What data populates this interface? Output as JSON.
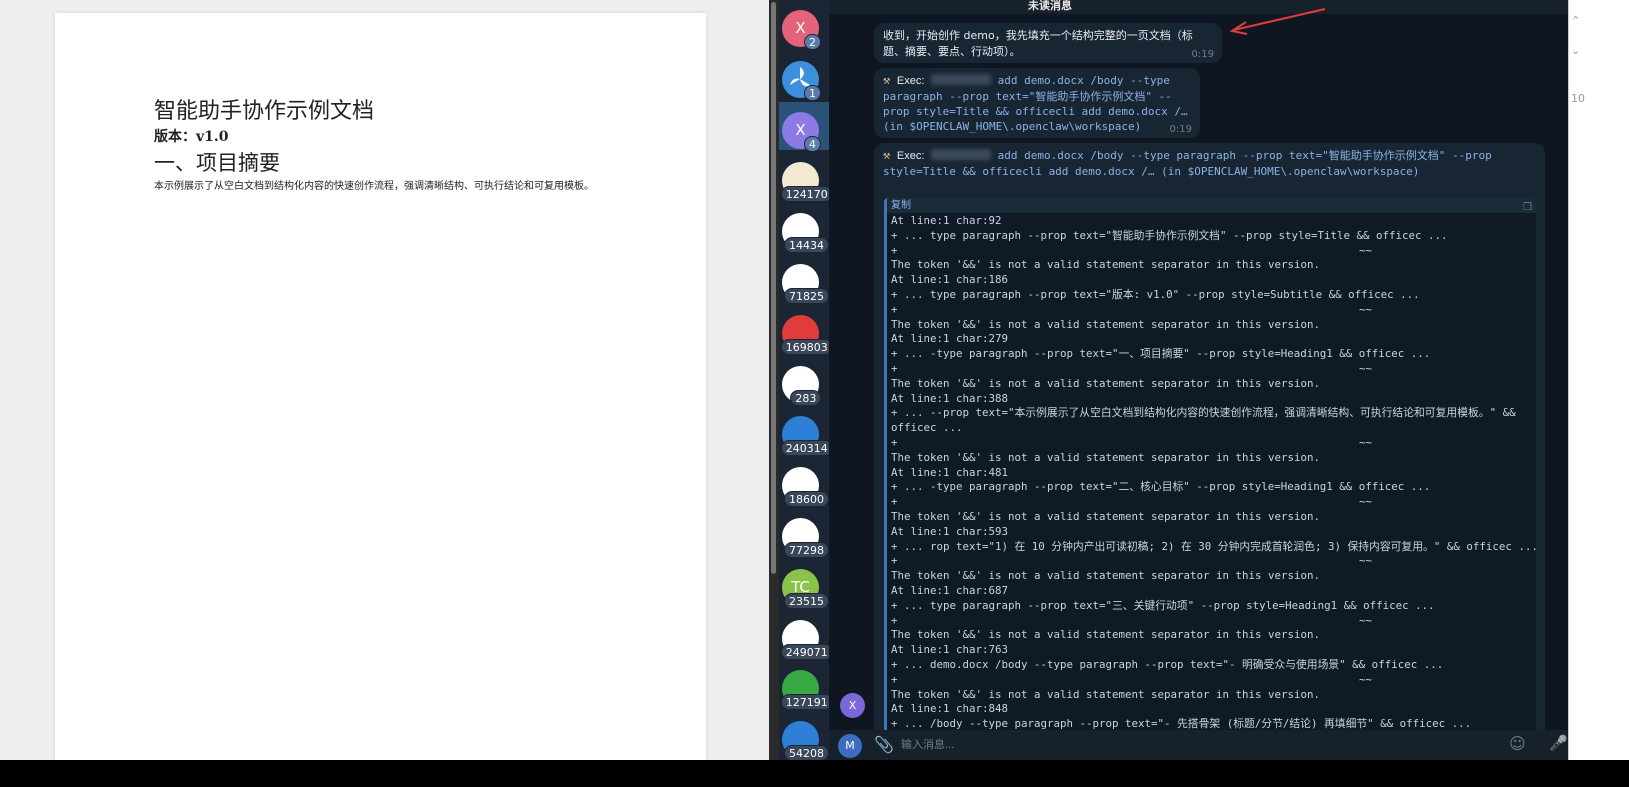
{
  "document": {
    "title": "智能助手协作示例文档",
    "subtitle": "版本：v1.0",
    "heading1": "一、项目摘要",
    "body": "本示例展示了从空白文档到结构化内容的快速创作流程，强调清晰结构、可执行结论和可复用模板。"
  },
  "chat_list": {
    "items": [
      {
        "initial": "X",
        "badge": "2",
        "color": "#e5637a"
      },
      {
        "initial": "",
        "badge": "1",
        "color": "#3d8fdc"
      },
      {
        "initial": "X",
        "badge": "4",
        "color": "#8c7ae6"
      },
      {
        "initial": "",
        "badge": "124170",
        "color": "#f3e9d2"
      },
      {
        "initial": "",
        "badge": "14434",
        "color": "#ffffff"
      },
      {
        "initial": "",
        "badge": "71825",
        "color": "#ffffff"
      },
      {
        "initial": "",
        "badge": "169803",
        "color": "#e23b3b"
      },
      {
        "initial": "",
        "badge": "283",
        "color": "#ffffff"
      },
      {
        "initial": "",
        "badge": "240314",
        "color": "#2e7fd6"
      },
      {
        "initial": "",
        "badge": "18600",
        "color": "#ffffff"
      },
      {
        "initial": "",
        "badge": "77298",
        "color": "#ffffff"
      },
      {
        "initial": "TC",
        "badge": "23515",
        "color": "#8bc34a"
      },
      {
        "initial": "",
        "badge": "249071",
        "color": "#ffffff"
      },
      {
        "initial": "",
        "badge": "127191",
        "color": "#39a845"
      },
      {
        "initial": "",
        "badge": "54208",
        "color": "#2e7fd6"
      }
    ]
  },
  "chat": {
    "header": "未读消息",
    "message1": {
      "text": "收到，开始创作 demo，我先填充一个结构完整的一页文档（标题、摘要、要点、行动项）。",
      "time": "0:19"
    },
    "message2": {
      "exec_label": "Exec:",
      "command": "add demo.docx /body --type paragraph --prop text=\"智能助手协作示例文档\" --prop style=Title && officecli add demo.docx /… (in $OPENCLAW_HOME\\.openclaw\\workspace)",
      "time": "0:19"
    },
    "message3": {
      "exec_label": "Exec:",
      "command": "add demo.docx /body --type paragraph --prop text=\"智能助手协作示例文档\" --prop style=Title && officecli add demo.docx /… (in $OPENCLAW_HOME\\.openclaw\\workspace)",
      "copy_label": "复制",
      "output_lines": [
        "At line:1 char:92",
        "+ ... type paragraph --prop text=\"智能助手协作示例文档\" --prop style=Title && officec ...",
        "+                                                                       ~~",
        "The token '&&' is not a valid statement separator in this version.",
        "At line:1 char:186",
        "+ ... type paragraph --prop text=\"版本: v1.0\" --prop style=Subtitle && officec ...",
        "+                                                                       ~~",
        "The token '&&' is not a valid statement separator in this version.",
        "At line:1 char:279",
        "+ ... -type paragraph --prop text=\"一、项目摘要\" --prop style=Heading1 && officec ...",
        "+                                                                       ~~",
        "The token '&&' is not a valid statement separator in this version.",
        "At line:1 char:388",
        "+ ... --prop text=\"本示例展示了从空白文档到结构化内容的快速创作流程，强调清晰结构、可执行结论和可复用模板。\" &&",
        "officec ...",
        "+                                                                       ~~",
        "The token '&&' is not a valid statement separator in this version.",
        "At line:1 char:481",
        "+ ... -type paragraph --prop text=\"二、核心目标\" --prop style=Heading1 && officec ...",
        "+                                                                       ~~",
        "The token '&&' is not a valid statement separator in this version.",
        "At line:1 char:593",
        "+ ... rop text=\"1) 在 10 分钟内产出可读初稿; 2) 在 30 分钟内完成首轮润色; 3) 保持内容可复用。\" && officec ...",
        "+                                                                       ~~",
        "The token '&&' is not a valid statement separator in this version.",
        "At line:1 char:687",
        "+ ... type paragraph --prop text=\"三、关键行动项\" --prop style=Heading1 && officec ...",
        "+                                                                       ~~",
        "The token '&&' is not a valid statement separator in this version.",
        "At line:1 char:763",
        "+ ... demo.docx /body --type paragraph --prop text=\"- 明确受众与使用场景\" && officec ...",
        "+                                                                       ~~",
        "The token '&&' is not a valid statement separator in this version.",
        "At line:1 char:848",
        "+ ... /body --type paragraph --prop text=\"- 先搭骨架 (标题/分节/结论) 再填细节\" && officec ..."
      ]
    },
    "sender_initial": "X"
  },
  "input": {
    "avatar_initial": "M",
    "placeholder": "输入消息..."
  },
  "right_strip": {
    "label": "10"
  }
}
